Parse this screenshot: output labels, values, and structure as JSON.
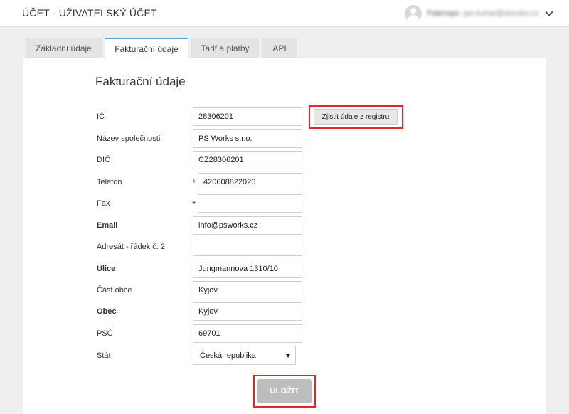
{
  "header": {
    "title": "ÚČET - UŽIVATELSKÝ ÚČET",
    "user_name": "Falenspo",
    "user_email": "jan.kuhar@seznbo.cz",
    "avatar_icon": "user-avatar-icon",
    "menu_icon": "chevron-down-icon"
  },
  "tabs": [
    {
      "label": "Základní údaje",
      "active": false
    },
    {
      "label": "Fakturační údaje",
      "active": true
    },
    {
      "label": "Tarif a platby",
      "active": false
    },
    {
      "label": "API",
      "active": false
    }
  ],
  "form": {
    "title": "Fakturační údaje",
    "phone_prefix": "+",
    "fax_prefix": "+",
    "fields": [
      {
        "label": "IČ",
        "value": "28306201",
        "bold": false
      },
      {
        "label": "Název společnosti",
        "value": "PS Works s.r.o.",
        "bold": false
      },
      {
        "label": "DIČ",
        "value": "CZ28306201",
        "bold": false
      },
      {
        "label": "Telefon",
        "value": "420608822026",
        "bold": false
      },
      {
        "label": "Fax",
        "value": "",
        "bold": false
      },
      {
        "label": "Email",
        "value": "info@psworks.cz",
        "bold": true
      },
      {
        "label": "Adresát - řádek č. 2",
        "value": "",
        "bold": false
      },
      {
        "label": "Ulice",
        "value": "Jungmannova 1310/10",
        "bold": true
      },
      {
        "label": "Část obce",
        "value": "Kyjov",
        "bold": false
      },
      {
        "label": "Obec",
        "value": "Kyjov",
        "bold": true
      },
      {
        "label": "PSČ",
        "value": "69701",
        "bold": false
      }
    ],
    "country": {
      "label": "Stát",
      "value": "Česká republika"
    },
    "registry_button": "Zjistit údaje z registru",
    "save_button": "ULOŽIT"
  },
  "colors": {
    "accent": "#5ba7d6",
    "highlight": "#e0272e",
    "save_disabled": "#bdbdbd",
    "background": "#efefef"
  }
}
